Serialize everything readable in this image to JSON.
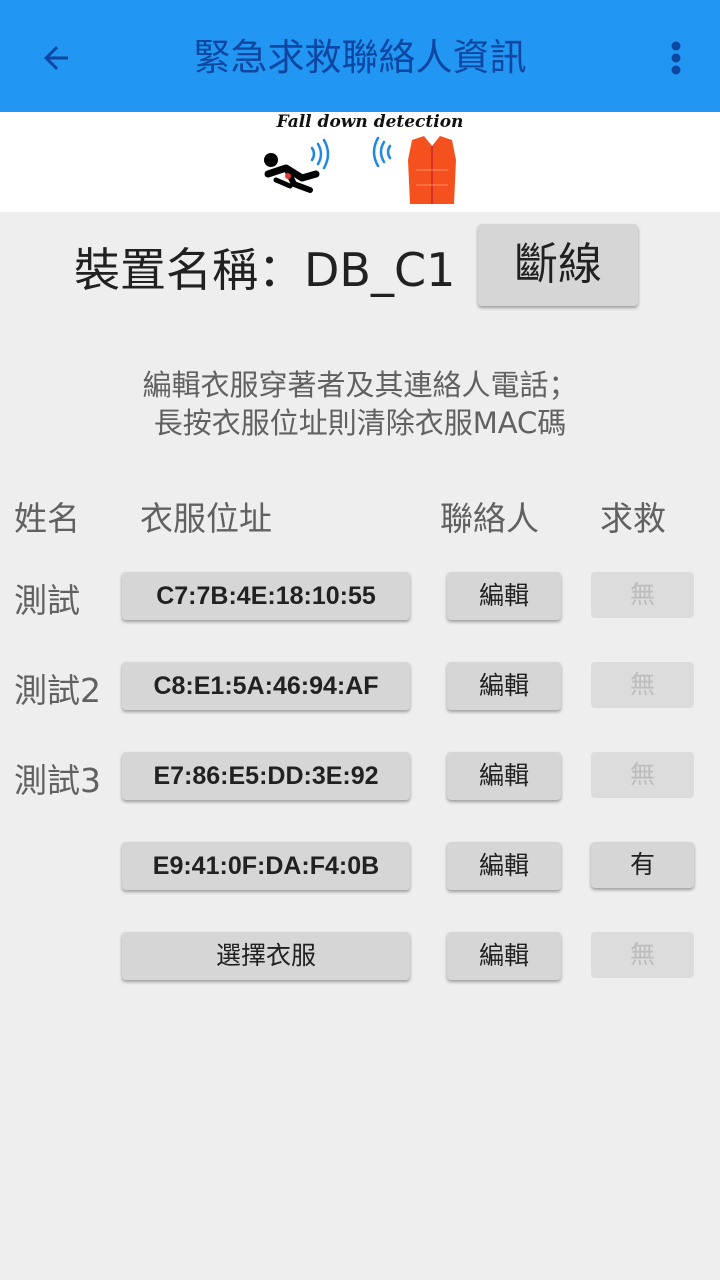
{
  "appbar": {
    "title": "緊急求救聯絡人資訊",
    "back_icon": "arrow-left-icon",
    "more_icon": "more-vert-icon",
    "color": "#2196f3"
  },
  "banner": {
    "text": "Fall down detection"
  },
  "device": {
    "name_label": "裝置名稱：DB_C1",
    "disconnect_label": "斷線"
  },
  "instructions": {
    "line1": "編輯衣服穿著者及其連絡人電話；",
    "line2": "長按衣服位址則清除衣服MAC碼"
  },
  "table": {
    "headers": {
      "name": "姓名",
      "address": "衣服位址",
      "contact": "聯絡人",
      "sos": "求救"
    },
    "rows": [
      {
        "name": "測試",
        "address": "C7:7B:4E:18:10:55",
        "contact": "編輯",
        "sos": "無"
      },
      {
        "name": "測試2",
        "address": "C8:E1:5A:46:94:AF",
        "contact": "編輯",
        "sos": "無"
      },
      {
        "name": "測試3",
        "address": "E7:86:E5:DD:3E:92",
        "contact": "編輯",
        "sos": "無"
      },
      {
        "name": "",
        "address": "E9:41:0F:DA:F4:0B",
        "contact": "編輯",
        "sos": "有"
      },
      {
        "name": "",
        "address": "選擇衣服",
        "contact": "編輯",
        "sos": "無"
      }
    ]
  }
}
